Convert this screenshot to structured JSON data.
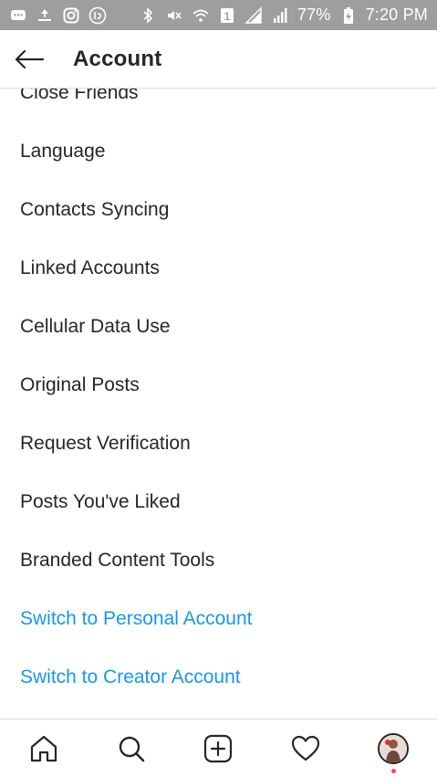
{
  "status_bar": {
    "battery": "77%",
    "time": "7:20 PM",
    "sim_slot": "1",
    "left_icons": [
      "message-icon",
      "sync-icon",
      "instagram-icon",
      "app-badge-icon"
    ],
    "right_icons": [
      "bluetooth-icon",
      "mute-icon",
      "wifi-icon",
      "sim-icon",
      "signal-icon",
      "signal-icon",
      "battery-charging-icon"
    ]
  },
  "header": {
    "title": "Account",
    "back_icon": "arrow-left-icon"
  },
  "menu": {
    "items": [
      {
        "label": "Close Friends"
      },
      {
        "label": "Language"
      },
      {
        "label": "Contacts Syncing"
      },
      {
        "label": "Linked Accounts"
      },
      {
        "label": "Cellular Data Use"
      },
      {
        "label": "Original Posts"
      },
      {
        "label": "Request Verification"
      },
      {
        "label": "Posts You've Liked"
      },
      {
        "label": "Branded Content Tools"
      }
    ],
    "links": [
      {
        "label": "Switch to Personal Account"
      },
      {
        "label": "Switch to Creator Account"
      }
    ]
  },
  "bottom_nav": {
    "items": [
      "home-icon",
      "search-icon",
      "new-post-icon",
      "activity-heart-icon",
      "profile-avatar"
    ]
  },
  "colors": {
    "status_bar_bg": "#9e9e9e",
    "text": "#262626",
    "link": "#1a96e6",
    "divider": "#dbdbdb",
    "notification_dot": "#ed4956"
  }
}
